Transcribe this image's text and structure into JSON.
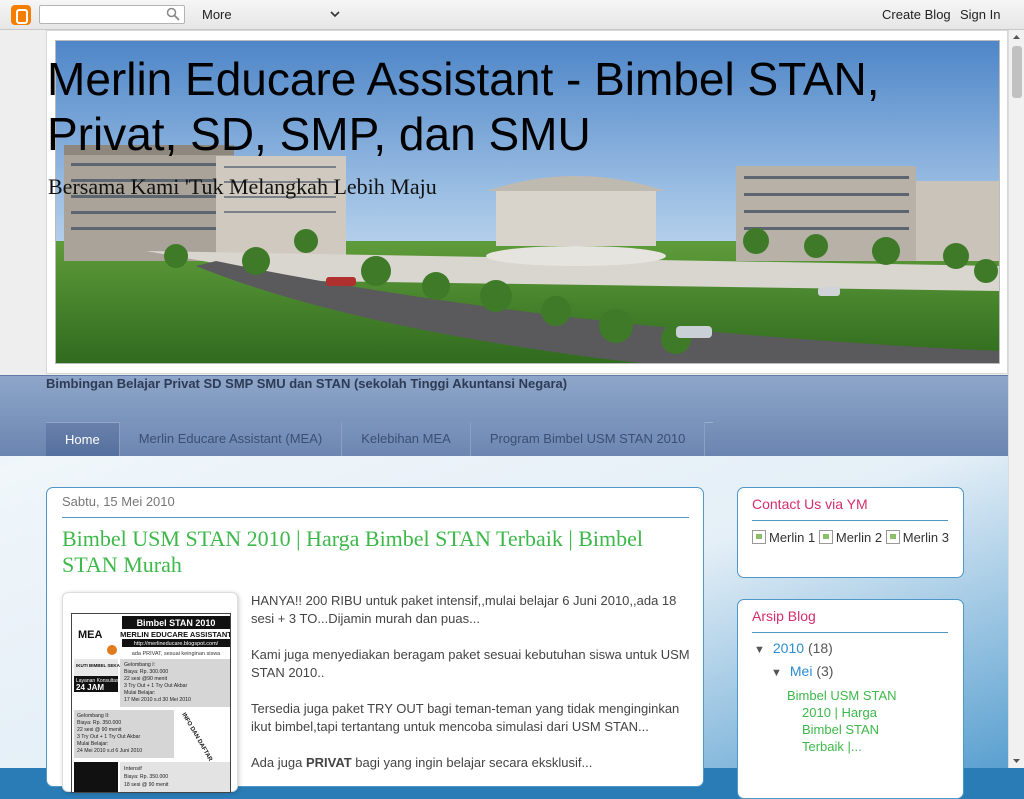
{
  "navbar": {
    "search_placeholder": "",
    "more_label": "More",
    "create_blog": "Create Blog",
    "sign_in": "Sign In"
  },
  "header": {
    "title": "Merlin Educare Assistant - Bimbel STAN, Privat, SD, SMP, dan SMU",
    "description": "Bersama Kami 'Tuk Melangkah Lebih Maju"
  },
  "tagline": "Bimbingan Belajar Privat SD SMP SMU dan STAN (sekolah Tinggi Akuntansi Negara)",
  "tabs": [
    {
      "label": "Home",
      "active": true
    },
    {
      "label": "Merlin Educare Assistant (MEA)"
    },
    {
      "label": "Kelebihan MEA"
    },
    {
      "label": "Program Bimbel USM STAN 2010"
    }
  ],
  "post": {
    "date": "Sabtu, 15 Mei 2010",
    "title": "Bimbel USM STAN 2010 | Harga Bimbel STAN Terbaik | Bimbel STAN Murah",
    "paragraphs": [
      "HANYA!! 200 RIBU untuk paket intensif,,mulai belajar 6 Juni 2010,,ada 18 sesi + 3 TO...Dijamin murah dan puas...",
      "Kami juga menyediakan beragam paket sesuai kebutuhan siswa untuk USM STAN 2010..",
      "Tersedia juga paket TRY OUT bagi teman-teman yang tidak menginginkan ikut bimbel,tapi tertantang untuk mencoba simulasi dari USM STAN..."
    ],
    "last_para_before": "Ada juga ",
    "last_para_bold": "PRIVAT",
    "last_para_after": " bagi yang ingin belajar secara eksklusif...",
    "flyer": {
      "heading": "Bimbel STAN 2010",
      "brand": "MERLIN EDUCARE ASSISTANT",
      "url": "http://merlineducare.blogspot.com/",
      "tagline": "ada PRIVAT, sesuai keinginan siswa",
      "mea": "MEA",
      "lines": [
        "Gelombang I:",
        "Biaya: Rp. 300.000",
        "22 sesi @90 menit",
        "3 Try Out + 1 Try Out Akbar",
        "Mulai Belajar:",
        "17 Mei 2010 s.d 30 Mei 2010"
      ],
      "lines2": [
        "Gelombang II:",
        "Biaya: Rp. 350.000",
        "22 sesi @ 90 menit",
        "3 Try Out + 1 Try Out Akbar",
        "Mulai Belajar:",
        "24 Mei 2010 s.d 6 Juni 2010"
      ],
      "consult": "Layanan Konsultasi",
      "hours": "24 JAM",
      "ikuti": "IKUTI BIMBEL SEKARANG, DOSIS NAP USM STAN!!",
      "info": "INFO DAN DAFTAR",
      "intensif": "Intensif",
      "intensif_price": "Biaya: Rp. 350.000",
      "intensif_sesi": "18 sesi @ 90 menit"
    }
  },
  "sidebar": {
    "contact": {
      "title": "Contact Us via YM",
      "items": [
        "Merlin 1",
        "Merlin 2",
        "Merlin 3"
      ]
    },
    "archive": {
      "title": "Arsip Blog",
      "year_toggle": "▼",
      "year": "2010",
      "year_count": "(18)",
      "month_toggle": "▼",
      "month": "Mei",
      "month_count": "(3)",
      "post": "Bimbel USM STAN 2010 | Harga Bimbel STAN Terbaik |..."
    }
  },
  "colors": {
    "title_green": "#3db84a",
    "widget_title": "#d42d6a",
    "border_blue": "#4f97c6",
    "tab_bar": "#6a85b0"
  }
}
